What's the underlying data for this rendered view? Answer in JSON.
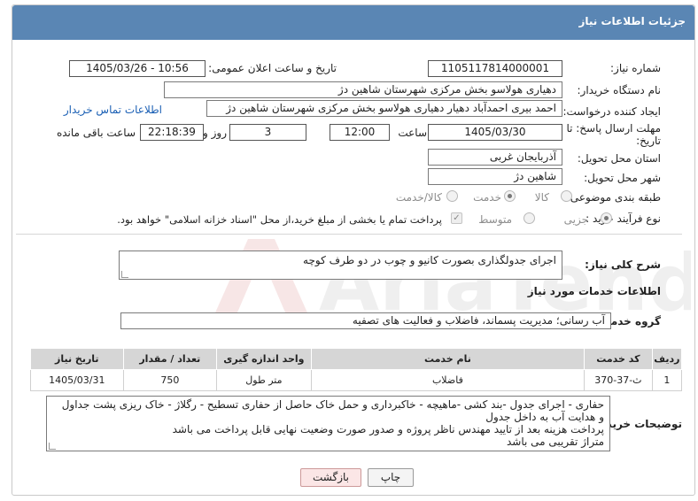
{
  "header": {
    "title": "جزئیات اطلاعات نیاز"
  },
  "fields": {
    "need_number_label": "شماره نیاز:",
    "need_number": "1105117814000001",
    "announce_label": "تاریخ و ساعت اعلان عمومی:",
    "announce_value": "1405/03/26 - 10:56",
    "buyer_org_label": "نام دستگاه خریدار:",
    "buyer_org": "دهیاری هولاسو بخش مرکزی شهرستان شاهین دژ",
    "creator_label": "ایجاد کننده درخواست:",
    "creator": "احمد بیری احمدآباد دهیار دهیاری هولاسو بخش مرکزی شهرستان شاهین دژ",
    "contact_link": "اطلاعات تماس خریدار",
    "deadline_label": "مهلت ارسال پاسخ: تا تاریخ:",
    "deadline_date": "1405/03/30",
    "time_label": "ساعت",
    "deadline_time": "12:00",
    "days_value": "3",
    "days_label": "روز و",
    "remaining_time": "22:18:39",
    "remaining_label": "ساعت باقی مانده",
    "province_label": "استان محل تحویل:",
    "province": "آذربایجان غربی",
    "city_label": "شهر محل تحویل:",
    "city": "شاهین دژ",
    "category_label": "طبقه بندی موضوعی:",
    "category_options": [
      "کالا",
      "خدمت",
      "کالا/خدمت"
    ],
    "purchase_label": "نوع فرآیند خرید :",
    "purchase_options": [
      "جزیی",
      "متوسط"
    ],
    "payment_note": "پرداخت تمام یا بخشی از مبلغ خرید،از محل \"اسناد خزانه اسلامی\" خواهد بود."
  },
  "description": {
    "label": "شرح کلی نیاز:",
    "value": "اجرای جدولگذاری بصورت کانیو و چوب در دو طرف کوچه"
  },
  "services_section": {
    "title": "اطلاعات خدمات مورد نیاز",
    "group_label": "گروه خدمت:",
    "group_value": "آب رسانی؛ مدیریت پسماند، فاضلاب و فعالیت های تصفیه"
  },
  "table": {
    "headers": [
      "ردیف",
      "کد خدمت",
      "نام خدمت",
      "واحد اندازه گیری",
      "تعداد / مقدار",
      "تاریخ نیاز"
    ],
    "rows": [
      [
        "1",
        "ث-37-370",
        "فاضلاب",
        "متر طول",
        "750",
        "1405/03/31"
      ]
    ]
  },
  "buyer_notes": {
    "label": "توضیحات خریدار:",
    "lines": [
      "حفاری - اجرای جدول -بند کشی -ماهیچه - خاکبرداری و حمل خاک حاصل از حفاری تسطیح - رگلاژ - خاک ریزی پشت جداول",
      "و هدایت آب به داخل جدول",
      "پرداخت هزینه بعد از تایید مهندس ناظر پروژه و صدور صورت وضعیت نهایی قابل پرداخت می باشد",
      "متراژ تقریبی می باشد"
    ]
  },
  "buttons": {
    "print": "چاپ",
    "back": "بازگشت"
  },
  "colors": {
    "header": "#5a86b4",
    "link": "#1a5fb4"
  }
}
